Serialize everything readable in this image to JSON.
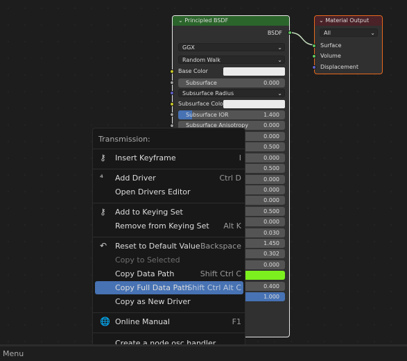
{
  "bsdf_node": {
    "title": "Principled BSDF",
    "output": "BSDF",
    "distribution": "GGX",
    "subsurface_method": "Random Walk",
    "base_color_label": "Base Color",
    "base_color": "#ebebeb",
    "subsurface_label": "Subsurface",
    "subsurface_value": "0.000",
    "subsurface_radius_label": "Subsurface Radius",
    "subsurface_color_label": "Subsurface Color",
    "subsurface_color": "#ebebeb",
    "subsurface_ior_label": "Subsurface IOR",
    "subsurface_ior_value": "1.400",
    "subsurface_anisotropy_label": "Subsurface Anisotropy",
    "subsurface_anisotropy_value": "0.000",
    "hidden_values": [
      "0.000",
      "0.500",
      "0.000",
      "0.500",
      "0.000",
      "0.000",
      "0.000",
      "0.500",
      "0.000",
      "0.030",
      "1.450",
      "0.302",
      "0.000",
      "",
      "0.400",
      "1.000"
    ],
    "emission_color": "#7cf01e"
  },
  "output_node": {
    "title": "Material Output",
    "target": "All",
    "inputs": [
      "Surface",
      "Volume",
      "Displacement"
    ]
  },
  "context_menu": {
    "title": "Transmission:",
    "items": [
      {
        "label": "Insert Keyframe",
        "shortcut": "I",
        "icon": "keyframe-icon"
      },
      {
        "label": "Add Driver",
        "shortcut": "Ctrl D",
        "icon": "driver-icon"
      },
      {
        "label": "Open Drivers Editor",
        "shortcut": ""
      },
      {
        "label": "Add to Keying Set",
        "shortcut": "",
        "icon": "keying-set-icon"
      },
      {
        "label": "Remove from Keying Set",
        "shortcut": "Alt K"
      },
      {
        "label": "Reset to Default Value",
        "shortcut": "Backspace",
        "icon": "undo-icon"
      },
      {
        "label": "Copy to Selected",
        "shortcut": "",
        "disabled": true
      },
      {
        "label": "Copy Data Path",
        "shortcut": "Shift Ctrl C"
      },
      {
        "label": "Copy Full Data Path",
        "shortcut": "Shift Ctrl Alt C",
        "highlighted": true
      },
      {
        "label": "Copy as New Driver",
        "shortcut": ""
      },
      {
        "label": "Online Manual",
        "shortcut": "F1",
        "icon": "globe-icon"
      },
      {
        "label": "Create a node osc handler",
        "shortcut": ""
      }
    ]
  },
  "status_bar": {
    "text": "Menu"
  },
  "colors": {
    "highlight": "#4772b3",
    "bsdf_header": "#2b652b",
    "output_border": "#e96a1d"
  }
}
